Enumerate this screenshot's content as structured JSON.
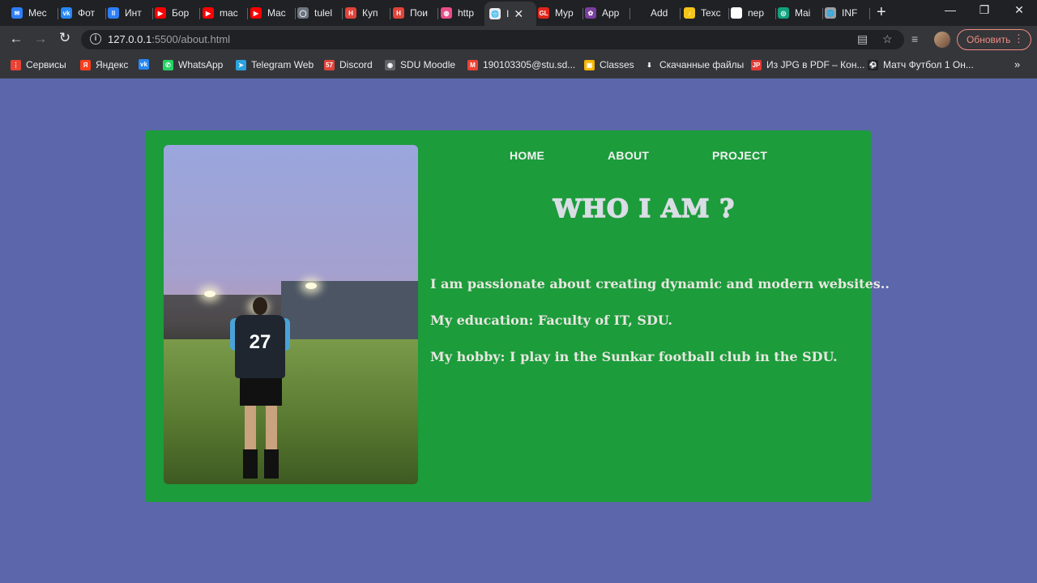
{
  "browser": {
    "tabs": [
      {
        "label": "Mec",
        "color": "#2d7ff9",
        "glyph": "✉"
      },
      {
        "label": "Фот",
        "color": "#2787f5",
        "glyph": "vk"
      },
      {
        "label": "Инт",
        "color": "#2d7ff9",
        "glyph": "ll"
      },
      {
        "label": "Бор",
        "color": "#ff0000",
        "glyph": "▶"
      },
      {
        "label": "mac",
        "color": "#ff0000",
        "glyph": "▶"
      },
      {
        "label": "Mac",
        "color": "#ff0000",
        "glyph": "▶"
      },
      {
        "label": "tulel",
        "color": "#6e7681",
        "glyph": "◯"
      },
      {
        "label": "Куп",
        "color": "#e0443a",
        "glyph": "H"
      },
      {
        "label": "Пои",
        "color": "#e0443a",
        "glyph": "H"
      },
      {
        "label": "http",
        "color": "#ea4c89",
        "glyph": "◍"
      },
      {
        "label": "I",
        "color": "#e8eaed",
        "glyph": "🌐"
      },
      {
        "label": "Myp",
        "color": "#e1251b",
        "glyph": "GL"
      },
      {
        "label": "App",
        "color": "#7b3fa0",
        "glyph": "✿"
      },
      {
        "label": "Add",
        "color": "#202124",
        "glyph": ""
      },
      {
        "label": "Texc",
        "color": "#f5c518",
        "glyph": "♪"
      },
      {
        "label": "nep",
        "color": "#ffffff",
        "glyph": "G"
      },
      {
        "label": "Mai",
        "color": "#10a37f",
        "glyph": "◎"
      },
      {
        "label": "INF",
        "color": "#9aa0a6",
        "glyph": "🌐"
      }
    ],
    "active_tab_index": 10,
    "new_tab": "+",
    "window_buttons": [
      "—",
      "❐",
      "✕"
    ],
    "url_host": "127.0.0.1",
    "url_path": ":5500/about.html",
    "update_label": "Обновить",
    "bookmarks": [
      {
        "label": "Сервисы",
        "color": "#ea4335",
        "glyph": "⋮"
      },
      {
        "label": "Яндекс",
        "color": "#fc3f1d",
        "glyph": "Я"
      },
      {
        "label": "",
        "color": "#2787f5",
        "glyph": "vk"
      },
      {
        "label": "WhatsApp",
        "color": "#25d366",
        "glyph": "✆"
      },
      {
        "label": "Telegram Web",
        "color": "#2aa3df",
        "glyph": "➤"
      },
      {
        "label": "Discord",
        "color": "#e0443a",
        "glyph": "57"
      },
      {
        "label": "SDU Moodle",
        "color": "#5f6368",
        "glyph": "◉"
      },
      {
        "label": "190103305@stu.sd...",
        "color": "#ea4335",
        "glyph": "M"
      },
      {
        "label": "Classes",
        "color": "#f4b400",
        "glyph": "▣"
      },
      {
        "label": "Скачанные файлы",
        "color": "#35363a",
        "glyph": "⬇"
      },
      {
        "label": "Из JPG в PDF – Кон...",
        "color": "#e53935",
        "glyph": "JP"
      },
      {
        "label": "Матч Футбол 1 Он...",
        "color": "#202124",
        "glyph": "⚽"
      }
    ],
    "bookmarks_more": "»"
  },
  "page": {
    "bg_color": "#5b67aa",
    "card_color": "#1c9c3b",
    "nav": {
      "home": "HOME",
      "about": "ABOUT",
      "project": "PROJECT"
    },
    "photo_jersey": "27",
    "heading": "WHO I AM ?",
    "paragraphs": [
      "I am passionate about creating dynamic and modern websites..",
      "My education: Faculty of IT, SDU.",
      "My hobby: I play in the Sunkar football club in the SDU."
    ]
  }
}
